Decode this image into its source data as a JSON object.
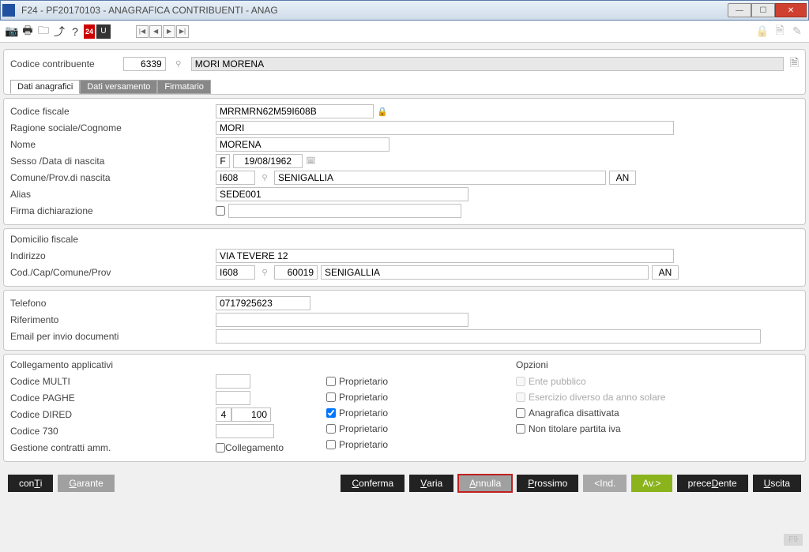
{
  "window": {
    "title": "F24  - PF20170103 -  ANAGRAFICA CONTRIBUENTI - ANAG"
  },
  "header": {
    "codice_label": "Codice contribuente",
    "codice_value": "6339",
    "name_value": "MORI MORENA"
  },
  "tabs": {
    "t1": "Dati anagrafici",
    "t2": "Dati versamento",
    "t3": "Firmatario"
  },
  "ana": {
    "cf_label": "Codice fiscale",
    "cf": "MRRMRN62M59I608B",
    "rag_label": "Ragione sociale/Cognome",
    "rag": "MORI",
    "nome_label": "Nome",
    "nome": "MORENA",
    "sesso_label": "Sesso /Data di nascita",
    "sesso": "F",
    "dn": "19/08/1962",
    "comune_label": "Comune/Prov.di nascita",
    "bc": "I608",
    "comune": "SENIGALLIA",
    "prov": "AN",
    "alias_label": "Alias",
    "alias": "SEDE001",
    "firma_label": "Firma dichiarazione",
    "firma": ""
  },
  "dom": {
    "title": "Domicilio fiscale",
    "indir_label": "Indirizzo",
    "indir": "VIA TEVERE 12",
    "cod_label": "Cod./Cap/Comune/Prov",
    "bc": "I608",
    "cap": "60019",
    "comune": "SENIGALLIA",
    "prov": "AN"
  },
  "contact": {
    "tel_label": "Telefono",
    "tel": "0717925623",
    "rif_label": "Riferimento",
    "rif": "",
    "email_label": "Email per invio documenti",
    "email": ""
  },
  "coll": {
    "title": "Collegamento applicativi",
    "multi_label": "Codice MULTI",
    "paghe_label": "Codice PAGHE",
    "dired_label": "Codice DIRED",
    "dired1": "4",
    "dired2": "100",
    "c730_label": "Codice 730",
    "gest_label": "Gestione contratti amm.",
    "gest_chk": "Collegamento",
    "prop": "Proprietario"
  },
  "opz": {
    "title": "Opzioni",
    "o1": "Ente pubblico",
    "o2": "Esercizio diverso da anno solare",
    "o3": "Anagrafica disattivata",
    "o4": "Non titolare partita iva"
  },
  "footer": {
    "conti": "conTi",
    "garante": "Garante",
    "conferma": "Conferma",
    "varia": "Varia",
    "annulla": "Annulla",
    "prossimo": "Prossimo",
    "ind": "<Ind.",
    "av": "Av.>",
    "precedente": "preceDente",
    "uscita": "Uscita",
    "f9": "F9"
  }
}
